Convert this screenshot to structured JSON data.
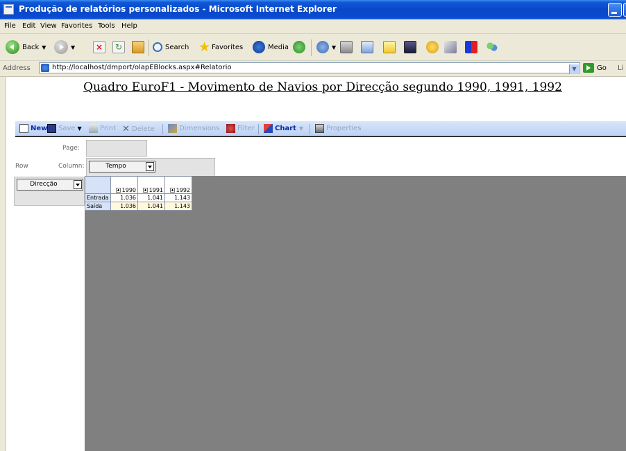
{
  "window": {
    "title": "Produção de relatórios personalizados - Microsoft Internet Explorer"
  },
  "menu": [
    "File",
    "Edit",
    "View",
    "Favorites",
    "Tools",
    "Help"
  ],
  "ie_toolbar": {
    "back": "Back",
    "search": "Search",
    "favorites": "Favorites",
    "media": "Media"
  },
  "address": {
    "label": "Address",
    "url": "http://localhost/dmport/olapEBlocks.aspx#Relatorio",
    "go": "Go",
    "links": "Li"
  },
  "report": {
    "title": "Quadro EuroF1 - Movimento de Navios por Direcção segundo 1990, 1991, 1992"
  },
  "report_toolbar": {
    "new": "New",
    "save": "Save",
    "print": "Print",
    "delete": "Delete",
    "dimensions": "Dimensions",
    "filter": "Filter",
    "chart": "Chart",
    "properties": "Properties"
  },
  "zones": {
    "page_label": "Page:",
    "row_label": "Row",
    "column_label": "Column:",
    "column_dimension": "Tempo",
    "row_dimension": "Direcção"
  },
  "pivot": {
    "columns": [
      "1990",
      "1991",
      "1992"
    ],
    "rows": [
      {
        "label": "Entrada",
        "values": [
          "1.036",
          "1.041",
          "1.143"
        ]
      },
      {
        "label": "Saída",
        "values": [
          "1.036",
          "1.041",
          "1.143"
        ]
      }
    ]
  },
  "colors": {
    "titlebar": "#0848c8",
    "chrome": "#ece9d8",
    "report_toolbar": "#c8daf8",
    "pivot_area": "#808080"
  }
}
